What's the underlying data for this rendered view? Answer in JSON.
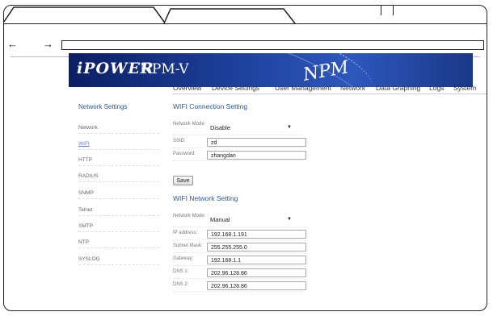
{
  "browser": {
    "back_glyph": "←",
    "forward_glyph": "→",
    "address": ""
  },
  "banner": {
    "logo": "iPOWER",
    "logo_sub": "",
    "title": "NPM-V",
    "big_text": "NPM"
  },
  "topnav": {
    "items": [
      "Overview",
      "Device Settings",
      "User Management",
      "Network",
      "Data Graphing",
      "Logs",
      "System"
    ]
  },
  "sidebar": {
    "title": "Network Settings",
    "items": [
      "Network",
      "WIFI",
      "HTTP",
      "RADIUS",
      "SNMP",
      "Telnet",
      "SMTP",
      "NTP",
      "SYSLOG"
    ],
    "active": "WIFI"
  },
  "wifi_connection": {
    "title": "WIFI Connection Setting",
    "network_mode_label": "Network Mode:",
    "network_mode_value": "Disable",
    "ssid_label": "SSID:",
    "ssid_value": "zd",
    "password_label": "Password:",
    "password_value": "zhangdan",
    "save_label": "Save"
  },
  "wifi_network": {
    "title": "WIFI Network Setting",
    "network_mode_label": "Network Mode:",
    "network_mode_value": "Manual",
    "ip_label": "IP address:",
    "ip_value": "192.168.1.191",
    "mask_label": "Subnet Mask:",
    "mask_value": "255.255.255.0",
    "gateway_label": "Gateway:",
    "gateway_value": "192.168.1.1",
    "dns1_label": "DNS 1:",
    "dns1_value": "202.96.128.86",
    "dns2_label": "DNS 2:",
    "dns2_value": "202.96.128.86"
  },
  "colors": {
    "accent_blue": "#2d5a9e",
    "banner_dark": "#0b1f63",
    "banner_light": "#2e58bd"
  }
}
